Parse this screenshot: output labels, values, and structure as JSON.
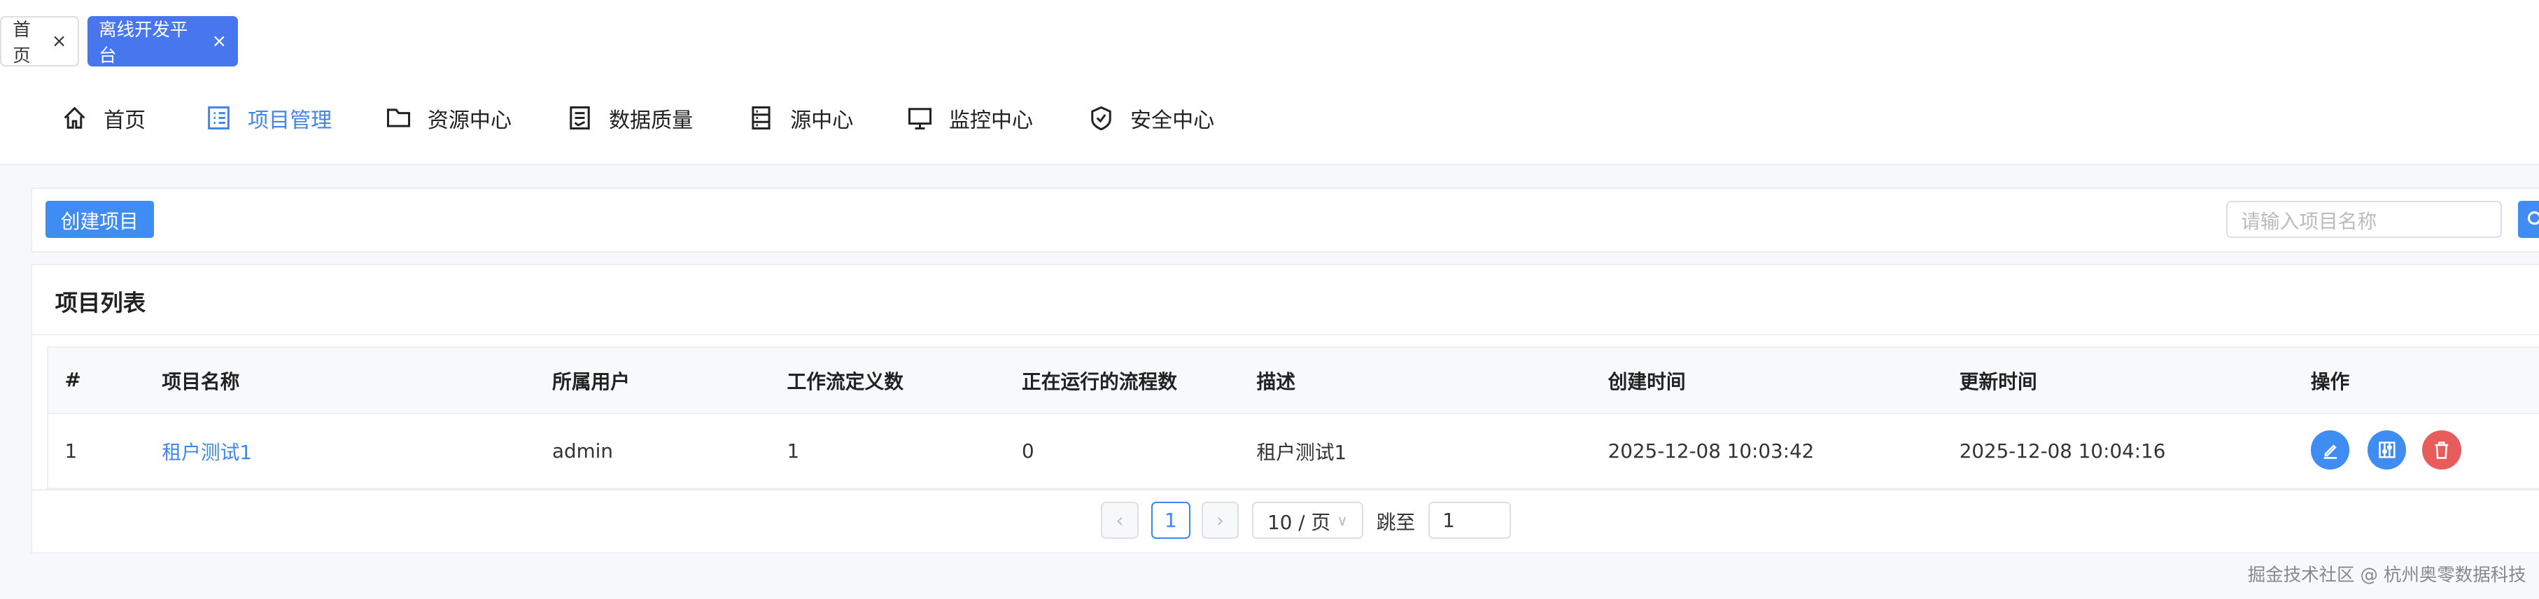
{
  "tabs": [
    {
      "label": "首页"
    },
    {
      "label": "离线开发平台"
    }
  ],
  "nav": [
    {
      "label": "首页",
      "icon": "home-icon"
    },
    {
      "label": "项目管理",
      "icon": "list-icon"
    },
    {
      "label": "资源中心",
      "icon": "folder-icon"
    },
    {
      "label": "数据质量",
      "icon": "document-check-icon"
    },
    {
      "label": "源中心",
      "icon": "server-icon"
    },
    {
      "label": "监控中心",
      "icon": "monitor-icon"
    },
    {
      "label": "安全中心",
      "icon": "shield-icon"
    }
  ],
  "toolbar": {
    "create_label": "创建项目",
    "search_placeholder": "请输入项目名称"
  },
  "list": {
    "title": "项目列表",
    "columns": [
      "#",
      "项目名称",
      "所属用户",
      "工作流定义数",
      "正在运行的流程数",
      "描述",
      "创建时间",
      "更新时间",
      "操作"
    ],
    "rows": [
      {
        "index": "1",
        "name": "租户测试1",
        "user": "admin",
        "workflows": "1",
        "running": "0",
        "desc": "租户测试1",
        "created": "2025-12-08 10:03:42",
        "updated": "2025-12-08 10:04:16"
      }
    ]
  },
  "pagination": {
    "current": "1",
    "page_size": "10 / 页",
    "jump_label": "跳至",
    "jump_value": "1"
  },
  "watermark": "掘金技术社区 @ 杭州奥零数据科技",
  "colors": {
    "accent": "#3f8cf3",
    "tab_active": "#4876ee",
    "danger": "#e85c5c"
  }
}
